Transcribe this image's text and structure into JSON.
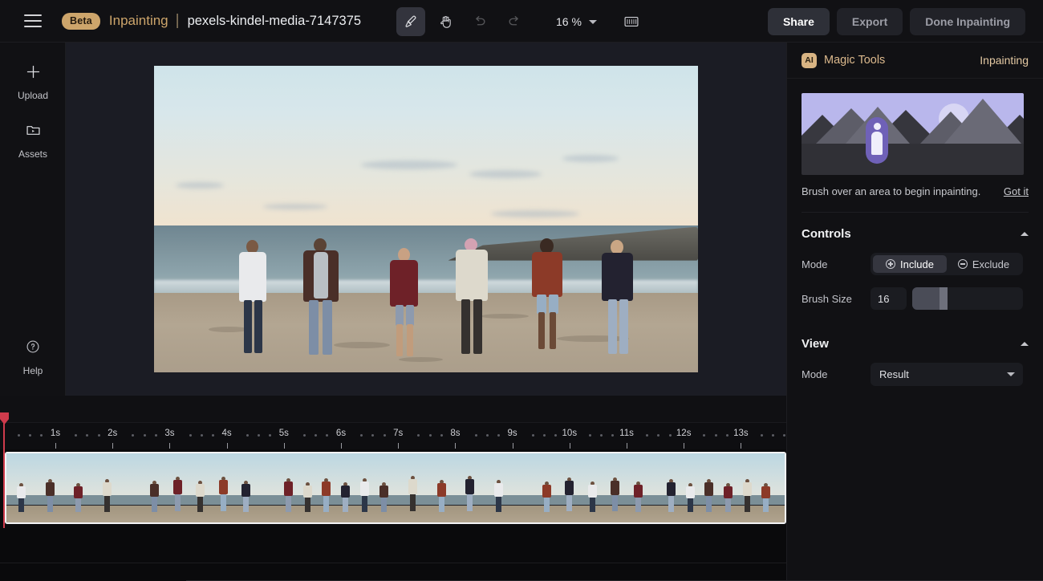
{
  "header": {
    "menu_icon": "hamburger-icon",
    "badge": "Beta",
    "mode_title": "Inpainting",
    "separator": "|",
    "file_name": "pexels-kindel-media-7147375",
    "tools": [
      {
        "name": "brush-tool",
        "icon": "brush-icon",
        "active": true
      },
      {
        "name": "hand-tool",
        "icon": "hand-icon",
        "active": false
      },
      {
        "name": "undo-button",
        "icon": "undo-icon",
        "active": false
      },
      {
        "name": "redo-button",
        "icon": "redo-icon",
        "active": false
      }
    ],
    "zoom_value": "16 %",
    "filmstrip_icon": "filmstrip-icon",
    "share_label": "Share",
    "export_label": "Export",
    "done_label": "Done Inpainting"
  },
  "sidebar": {
    "items": [
      {
        "label": "Upload",
        "icon": "plus-icon"
      },
      {
        "label": "Assets",
        "icon": "folder-video-icon"
      }
    ],
    "help": {
      "label": "Help",
      "icon": "question-circle-icon"
    }
  },
  "panel": {
    "badge": "AI",
    "title": "Magic Tools",
    "mode": "Inpainting",
    "promo": {
      "text": "Brush over an area to begin inpainting.",
      "link": "Got it"
    },
    "controls": {
      "title": "Controls",
      "mode_label": "Mode",
      "include_label": "Include",
      "exclude_label": "Exclude",
      "selected_mode": "Include",
      "brush_label": "Brush Size",
      "brush_value": "16"
    },
    "view": {
      "title": "View",
      "mode_label": "Mode",
      "mode_value": "Result"
    }
  },
  "timeline": {
    "ticks": [
      "1s",
      "2s",
      "3s",
      "4s",
      "5s",
      "6s",
      "7s",
      "8s",
      "9s",
      "10s",
      "11s",
      "12s",
      "13s"
    ],
    "playhead_position": "0s"
  },
  "colors": {
    "accent_tan": "#cda56b",
    "panel_bg": "#111114",
    "canvas_bg": "#1b1c24",
    "playhead_red": "#cf3b4c",
    "promo_sky": "#b9b7ec",
    "promo_person": "#6f61b8"
  }
}
